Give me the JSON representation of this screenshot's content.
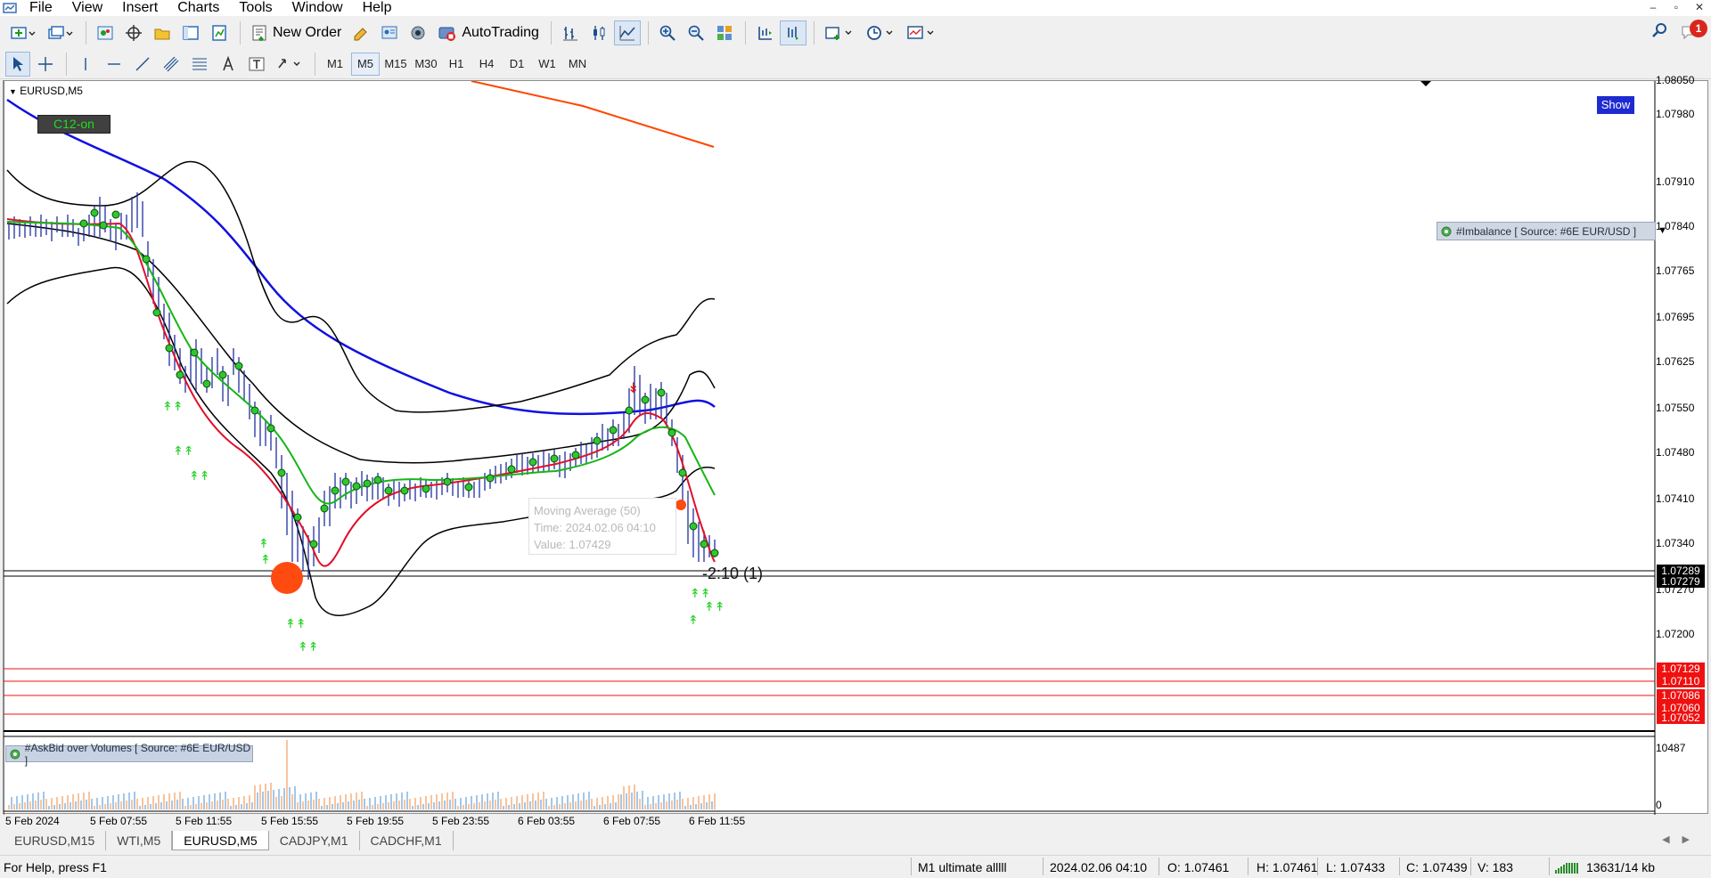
{
  "menu": [
    "File",
    "View",
    "Insert",
    "Charts",
    "Tools",
    "Window",
    "Help"
  ],
  "window_controls": [
    "–",
    "▫",
    "✕"
  ],
  "toolbar": {
    "new_order_label": "New Order",
    "autotrading_label": "AutoTrading",
    "notification_count": "1"
  },
  "timeframes": [
    {
      "label": "M1",
      "active": false
    },
    {
      "label": "M5",
      "active": true
    },
    {
      "label": "M15",
      "active": false
    },
    {
      "label": "M30",
      "active": false
    },
    {
      "label": "H1",
      "active": false
    },
    {
      "label": "H4",
      "active": false
    },
    {
      "label": "D1",
      "active": false
    },
    {
      "label": "W1",
      "active": false
    },
    {
      "label": "MN",
      "active": false
    }
  ],
  "chart": {
    "symbol_label": "EURUSD,M5",
    "c12_label": "C12-on",
    "show_label": "Show",
    "imbalance_label": "#Imbalance [ Source: #6E EUR/USD ]",
    "askbid_label": "#AskBid over Volumes [ Source: #6E EUR/USD ]",
    "mark_label": "-2:10 (1)",
    "tooltip": {
      "line1": "Moving Average (50)",
      "line2": "Time: 2024.02.06 04:10",
      "line3": "Value: 1.07429"
    },
    "price_scale": [
      "1.08050",
      "1.07980",
      "1.07910",
      "1.07840",
      "1.07765",
      "1.07695",
      "1.07625",
      "1.07550",
      "1.07480",
      "1.07410",
      "1.07340",
      "1.07270",
      "1.07200"
    ],
    "price_boxes": [
      {
        "value": "1.07289",
        "style": "black"
      },
      {
        "value": "1.07279",
        "style": "black"
      },
      {
        "value": "1.07129",
        "style": "red"
      },
      {
        "value": "1.07110",
        "style": "red"
      },
      {
        "value": "1.07086",
        "style": "red"
      },
      {
        "value": "1.07060",
        "style": "red"
      },
      {
        "value": "1.07052",
        "style": "red"
      }
    ],
    "volume_scale_max": "10487",
    "volume_scale_min": "0",
    "time_labels": [
      "5 Feb 2024",
      "5 Feb 07:55",
      "5 Feb 11:55",
      "5 Feb 15:55",
      "5 Feb 19:55",
      "5 Feb 23:55",
      "6 Feb 03:55",
      "6 Feb 07:55",
      "6 Feb 11:55"
    ],
    "colors": {
      "ma_blue": "#1010e0",
      "ma_orange": "#ff4500",
      "bands": "#000000",
      "ema_fast": "#e0102a",
      "ema_slow": "#17b517",
      "level_lines": "#f01010"
    }
  },
  "tabs": [
    {
      "label": "EURUSD,M15",
      "active": false
    },
    {
      "label": "WTI,M5",
      "active": false
    },
    {
      "label": "EURUSD,M5",
      "active": true
    },
    {
      "label": "CADJPY,M1",
      "active": false
    },
    {
      "label": "CADCHF,M1",
      "active": false
    }
  ],
  "status": {
    "help": "For Help, press F1",
    "profile": "M1 ultimate alllll",
    "datetime": "2024.02.06 04:10",
    "open": "O: 1.07461",
    "high": "H: 1.07461",
    "low": "L: 1.07433",
    "close": "C: 1.07439",
    "volume": "V: 183",
    "traffic": "13631/14 kb"
  }
}
